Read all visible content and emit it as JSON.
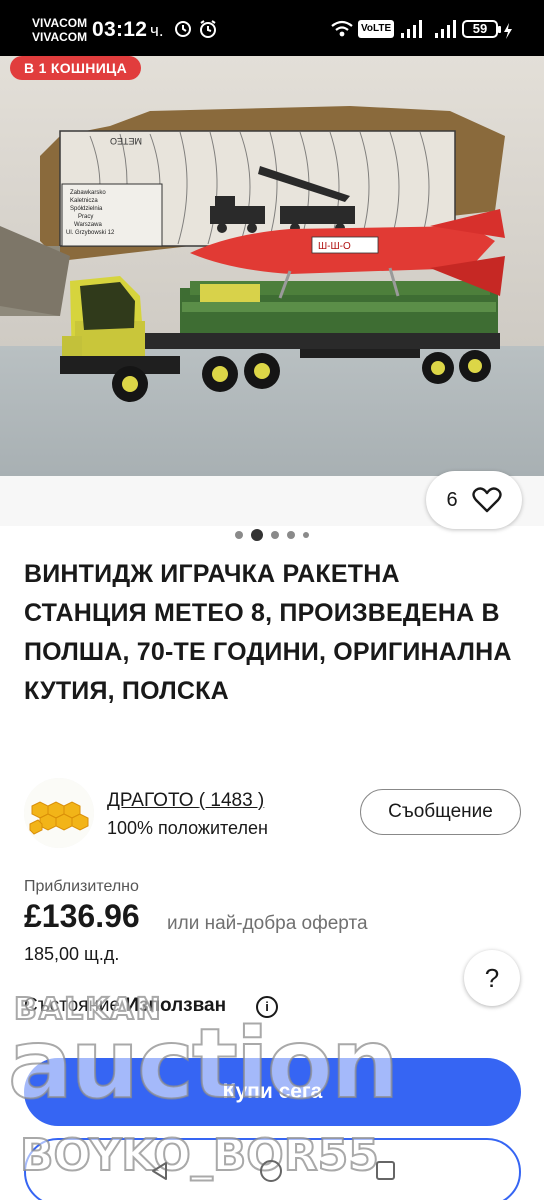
{
  "status_bar": {
    "carrier_1": "VIVACOM",
    "carrier_2": "VIVACOM",
    "time": "03:12",
    "time_suffix": "ч.",
    "volte": "VoLTE",
    "battery": "59"
  },
  "listing": {
    "cart_badge": "В 1 КОШНИЦА",
    "watch_count": "6",
    "image_index": 2,
    "image_count": 5,
    "title": "ВИНТИДЖ ИГРАЧКА РАКЕТНА СТАНЦИЯ МЕТЕО 8, ПРОИЗВЕДЕНА В ПОЛША, 70-ТЕ ГОДИНИ, ОРИГИНАЛНА КУТИЯ, ПОЛСКА",
    "box_print_1": "Zabawkarsko",
    "box_print_2": "Kaletnicza",
    "box_print_3": "Spółdzielnia",
    "box_print_4": "Pracy",
    "box_print_5": "Warszawa",
    "box_print_6": "Ul. Grzybowski 12",
    "box_side_text": "METEO",
    "rocket_label": "Ш-Ш-О"
  },
  "seller": {
    "name": "ДРАГОТО",
    "feedback": "( 1483 )",
    "positive": "100% положителен",
    "message_button": "Съобщение"
  },
  "price": {
    "approx_label": "Приблизително",
    "amount": "£136.96",
    "offer_text": "или най-добра оферта",
    "local_price": "185,00 щ.д."
  },
  "help_label": "?",
  "condition": {
    "label": "Състояние",
    "value": "Използван",
    "info_glyph": "i"
  },
  "buy_button": "Купи сега",
  "watermark": {
    "top": "BALKAN",
    "main": "auction",
    "user": "BOYKO_BOR55"
  },
  "colors": {
    "primary_blue": "#3665f3",
    "badge_red": "#e13d3d",
    "status_bar_bg": "#000000"
  },
  "icons": [
    "heart-icon",
    "wifi-icon",
    "signal-icon",
    "alarm-icon",
    "battery-icon",
    "info-icon",
    "nav-back-icon",
    "nav-home-icon",
    "nav-recent-icon"
  ]
}
